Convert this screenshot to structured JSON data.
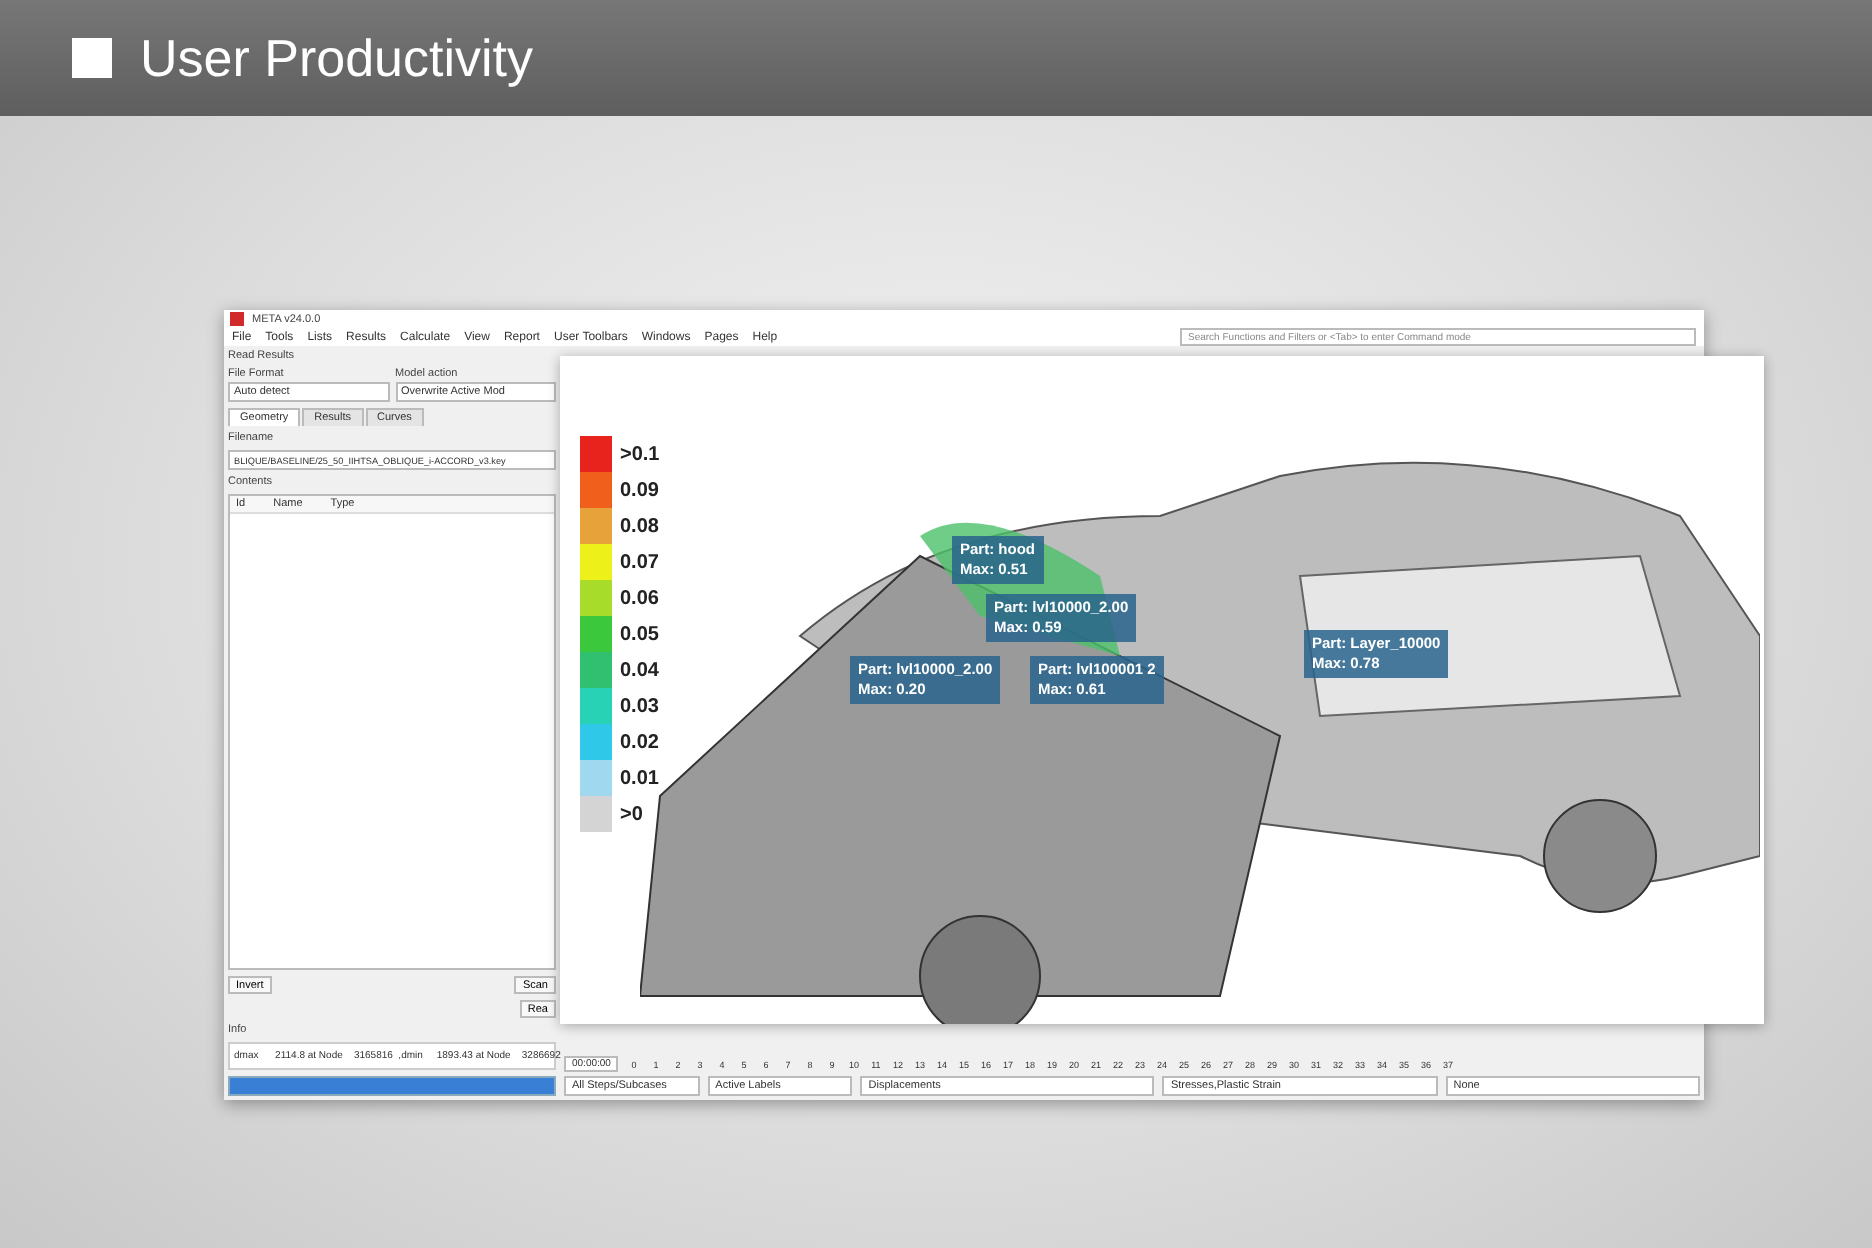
{
  "slide": {
    "title": "User Productivity"
  },
  "window": {
    "title": "META v24.0.0",
    "menu": [
      "File",
      "Tools",
      "Lists",
      "Results",
      "Calculate",
      "View",
      "Report",
      "User Toolbars",
      "Windows",
      "Pages",
      "Help"
    ],
    "search": {
      "placeholder": "Search Functions and Filters or <Tab> to enter Command mode"
    }
  },
  "read_results": {
    "title": "Read Results",
    "file_format": {
      "label": "File Format",
      "value": "Auto detect"
    },
    "model_action": {
      "label": "Model action",
      "value": "Overwrite Active Mod"
    },
    "tabs": [
      {
        "label": "Geometry",
        "selected": true
      },
      {
        "label": "Results",
        "selected": false
      },
      {
        "label": "Curves",
        "selected": false
      }
    ],
    "filename": {
      "label": "Filename",
      "value": "BLIQUE/BASELINE/25_50_IIHTSA_OBLIQUE_i-ACCORD_v3.key"
    },
    "contents": {
      "label": "Contents",
      "columns": [
        "Id",
        "Name",
        "Type"
      ]
    },
    "buttons": [
      "Invert",
      "Scan",
      "Rea"
    ]
  },
  "info": {
    "title": "Info",
    "line": "dmax      2114.8 at Node    3165816  ,dmin     1893.43 at Node    3286692"
  },
  "legend": [
    {
      "label": ">0.1",
      "color": "#e8231e"
    },
    {
      "label": "0.09",
      "color": "#f0601c"
    },
    {
      "label": "0.08",
      "color": "#e8a23a"
    },
    {
      "label": "0.07",
      "color": "#eef01a"
    },
    {
      "label": "0.06",
      "color": "#a8dc2a"
    },
    {
      "label": "0.05",
      "color": "#3cc83c"
    },
    {
      "label": "0.04",
      "color": "#30c070"
    },
    {
      "label": "0.03",
      "color": "#28d2b4"
    },
    {
      "label": "0.02",
      "color": "#30c8e8"
    },
    {
      "label": "0.01",
      "color": "#a0d8f0"
    },
    {
      "label": ">0",
      "color": "#d4d4d4"
    }
  ],
  "labels": [
    {
      "part": "Part: hood",
      "max": "Max: 0.51"
    },
    {
      "part": "Part: lvl10000_2.00",
      "max": "Max: 0.59"
    },
    {
      "part": "Part: lvl10000_2.00",
      "max": "Max: 0.20"
    },
    {
      "part": "Part: lvl100001 2",
      "max": "Max: 0.61"
    },
    {
      "part": "Part: Layer_10000",
      "max": "Max: 0.78"
    }
  ],
  "timeline": {
    "time": "00:00:00",
    "frames": [
      "0",
      "1",
      "2",
      "3",
      "4",
      "5",
      "6",
      "7",
      "8",
      "9",
      "10",
      "11",
      "12",
      "13",
      "14",
      "15",
      "16",
      "17",
      "18",
      "19",
      "20",
      "21",
      "22",
      "23",
      "24",
      "25",
      "26",
      "27",
      "28",
      "29",
      "30",
      "31",
      "32",
      "33",
      "34",
      "35",
      "36",
      "37"
    ]
  },
  "status_dropdowns": [
    "All Steps/Subcases",
    "Active Labels",
    "Displacements",
    "Stresses,Plastic Strain",
    "None"
  ]
}
